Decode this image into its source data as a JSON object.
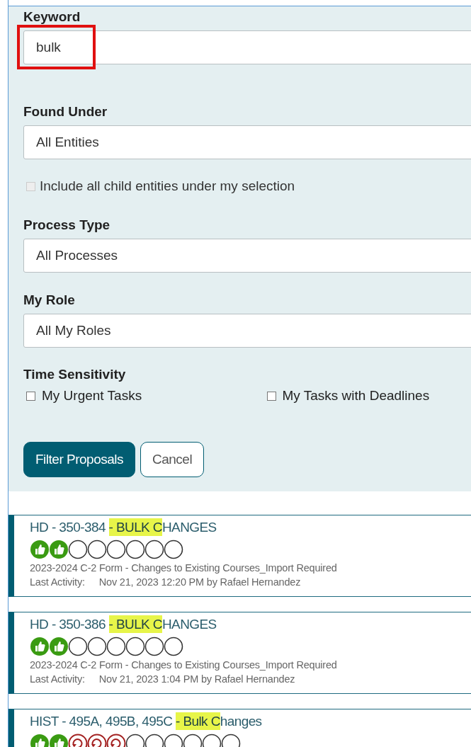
{
  "filters": {
    "keyword": {
      "label": "Keyword",
      "value": "bulk",
      "annotated": true
    },
    "found_under": {
      "label": "Found Under",
      "value": "All Entities"
    },
    "include_children": {
      "label": "Include all child entities under my selection",
      "checked": false,
      "disabled": true
    },
    "process_type": {
      "label": "Process Type",
      "value": "All Processes"
    },
    "my_role": {
      "label": "My Role",
      "value": "All My Roles"
    },
    "time_sensitivity": {
      "label": "Time Sensitivity",
      "options": [
        {
          "label": "My Urgent Tasks",
          "checked": false
        },
        {
          "label": "My Tasks with Deadlines",
          "checked": false
        }
      ]
    },
    "buttons": [
      {
        "label": "Filter Proposals",
        "kind": "primary"
      },
      {
        "label": "Cancel",
        "kind": "secondary"
      }
    ]
  },
  "proposals": [
    {
      "title": [
        "HD - 350-384 ",
        "- BULK C",
        "HANGES"
      ],
      "steps": [
        {
          "kind": "approved"
        },
        {
          "kind": "approved"
        },
        {
          "kind": "pending"
        },
        {
          "kind": "pending"
        },
        {
          "kind": "pending"
        },
        {
          "kind": "pending"
        },
        {
          "kind": "pending"
        },
        {
          "kind": "pending"
        }
      ],
      "form": "2023-2024 C-2 Form - Changes to Existing Courses_Import Required",
      "activity_label": "Last Activity:",
      "activity": "Nov 21, 2023 12:20 PM by Rafael Hernandez"
    },
    {
      "title": [
        "HD - 350-386 ",
        "- BULK C",
        "HANGES"
      ],
      "steps": [
        {
          "kind": "approved"
        },
        {
          "kind": "approved"
        },
        {
          "kind": "pending"
        },
        {
          "kind": "pending"
        },
        {
          "kind": "pending"
        },
        {
          "kind": "pending"
        },
        {
          "kind": "pending"
        },
        {
          "kind": "pending"
        }
      ],
      "form": "2023-2024 C-2 Form - Changes to Existing Courses_Import Required",
      "activity_label": "Last Activity:",
      "activity": "Nov 21, 2023 1:04 PM by Rafael Hernandez"
    },
    {
      "title": [
        "HIST - 495A, 495B, 495C ",
        "- Bulk C",
        "hanges"
      ],
      "steps": [
        {
          "kind": "approved"
        },
        {
          "kind": "approved"
        },
        {
          "kind": "returned"
        },
        {
          "kind": "returned"
        },
        {
          "kind": "returned"
        },
        {
          "kind": "pending"
        },
        {
          "kind": "pending"
        },
        {
          "kind": "pending"
        },
        {
          "kind": "pending"
        },
        {
          "kind": "pending"
        },
        {
          "kind": "pending"
        }
      ]
    }
  ]
}
